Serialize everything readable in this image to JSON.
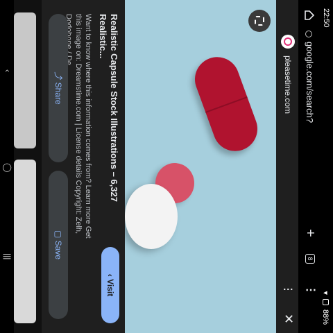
{
  "status": {
    "time": "22:50",
    "battery": "88%"
  },
  "browser": {
    "url": "google.com/search?",
    "tab_count": "8"
  },
  "source": {
    "site": "pleasetime.com"
  },
  "result": {
    "title": "Realistic Capsule Stock Illustrations – 6,327 Realistic...",
    "description": "Want to know where this information comes from? Learn more Get this image on: Dreamstime.com | License details Copyright: Zelh, Dodobone / De...",
    "visit_label": "Visit",
    "share_label": "Share",
    "save_label": "Save"
  },
  "icons": [
    "home-icon",
    "plus-icon",
    "tab-switcher-icon",
    "more-vert-icon",
    "close-icon",
    "lens-icon",
    "share-icon",
    "bookmark-icon",
    "chevron-right-icon"
  ]
}
